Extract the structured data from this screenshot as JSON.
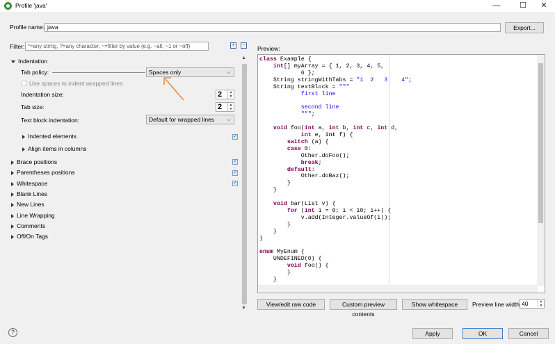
{
  "window": {
    "title": "Profile 'java'",
    "minimize": "—",
    "maximize": "☐",
    "close": "✕"
  },
  "profile": {
    "label": "Profile name:",
    "value": "java",
    "export_label": "Export..."
  },
  "filter": {
    "label": "Filter:",
    "placeholder": "*=any string, ?=any character, ~=filter by value (e.g. ~all, ~1 or ~off)"
  },
  "tree": {
    "indentation": {
      "label": "Indentation",
      "tab_policy_label": "Tab policy:",
      "tab_policy_value": "Spaces only",
      "wrap_spaces_label": "Use spaces to indent wrapped lines",
      "indentation_size_label": "Indentation size:",
      "indentation_size_value": "2",
      "tab_size_label": "Tab size:",
      "tab_size_value": "2",
      "text_block_label": "Text block indentation:",
      "text_block_value": "Default for wrapped lines",
      "indented_elements": "Indented elements",
      "align_items": "Align items in columns"
    },
    "sections": [
      "Brace positions",
      "Parentheses positions",
      "Whitespace",
      "Blank Lines",
      "New Lines",
      "Line Wrapping",
      "Comments",
      "Off/On Tags"
    ]
  },
  "preview": {
    "label": "Preview:",
    "buttons": {
      "view_raw": "View/edit raw code",
      "custom": "Custom preview contents",
      "whitespace": "Show whitespace"
    },
    "width_label": "Preview line width:",
    "width_value": "40"
  },
  "footer": {
    "apply": "Apply",
    "ok": "OK",
    "cancel": "Cancel",
    "help": "?"
  },
  "colors": {
    "arrow": "#f0883e",
    "keyword": "#7f0055",
    "string": "#2a00ff"
  }
}
